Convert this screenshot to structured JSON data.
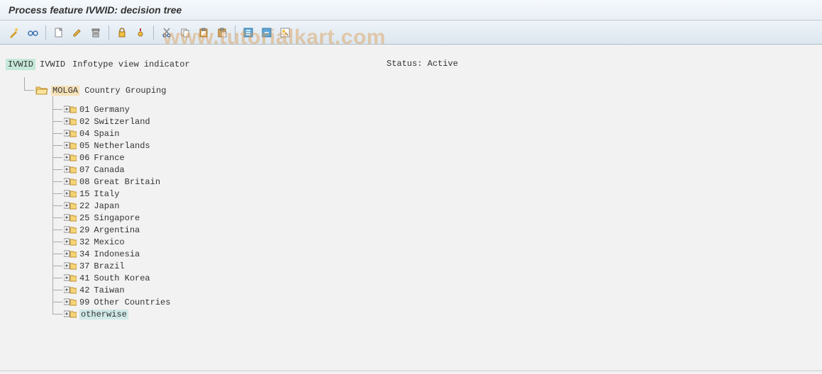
{
  "title": "Process feature IVWID: decision tree",
  "watermark": "www.tutorialkart.com",
  "toolbar": {
    "icons": [
      "wand-icon",
      "glasses-icon",
      "new-icon",
      "edit-icon",
      "delete-icon",
      "lock-icon",
      "info-icon",
      "cut-icon",
      "copy-icon",
      "paste-icon",
      "pastespec-icon",
      "expand-icon",
      "collapse-icon",
      "where-icon"
    ]
  },
  "root": {
    "badge": "IVWID",
    "code": "IVWID",
    "desc": "Infotype view indicator"
  },
  "status_label": "Status:",
  "status_value": "Active",
  "group": {
    "code": "MOLGA",
    "desc": "Country Grouping"
  },
  "leaves": [
    {
      "code": "01",
      "desc": "Germany"
    },
    {
      "code": "02",
      "desc": "Switzerland"
    },
    {
      "code": "04",
      "desc": "Spain"
    },
    {
      "code": "05",
      "desc": "Netherlands"
    },
    {
      "code": "06",
      "desc": "France"
    },
    {
      "code": "07",
      "desc": "Canada"
    },
    {
      "code": "08",
      "desc": "Great Britain"
    },
    {
      "code": "15",
      "desc": "Italy"
    },
    {
      "code": "22",
      "desc": "Japan"
    },
    {
      "code": "25",
      "desc": "Singapore"
    },
    {
      "code": "29",
      "desc": "Argentina"
    },
    {
      "code": "32",
      "desc": "Mexico"
    },
    {
      "code": "34",
      "desc": "Indonesia"
    },
    {
      "code": "37",
      "desc": "Brazil"
    },
    {
      "code": "41",
      "desc": "South Korea"
    },
    {
      "code": "42",
      "desc": "Taiwan"
    },
    {
      "code": "99",
      "desc": "Other Countries"
    }
  ],
  "otherwise": "otherwise"
}
